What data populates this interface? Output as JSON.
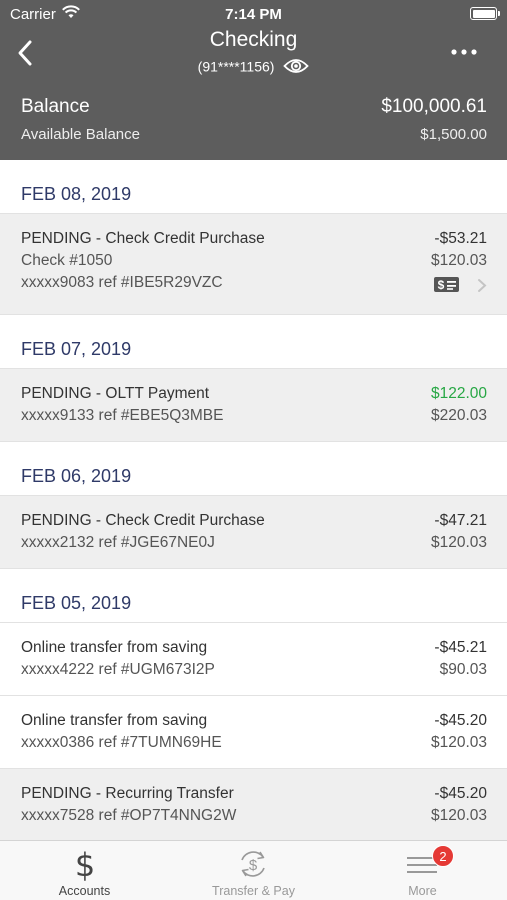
{
  "status_bar": {
    "carrier": "Carrier",
    "time": "7:14 PM"
  },
  "header": {
    "title": "Checking",
    "account_number": "(91****1156)",
    "balance_label": "Balance",
    "balance_value": "$100,000.61",
    "available_label": "Available Balance",
    "available_value": "$1,500.00"
  },
  "groups": [
    {
      "date": "FEB 08, 2019",
      "items": [
        {
          "description": "PENDING - Check Credit Purchase",
          "check": "Check #1050",
          "ref": "xxxxx9083 ref #IBE5R29VZC",
          "amount": "-$53.21",
          "balance": "$120.03"
        }
      ]
    },
    {
      "date": "FEB 07, 2019",
      "items": [
        {
          "description": "PENDING - OLTT Payment",
          "ref": "xxxxx9133 ref #EBE5Q3MBE",
          "amount": "$122.00",
          "balance": "$220.03"
        }
      ]
    },
    {
      "date": "FEB 06, 2019",
      "items": [
        {
          "description": "PENDING - Check Credit Purchase",
          "ref": "xxxxx2132 ref #JGE67NE0J",
          "amount": "-$47.21",
          "balance": "$120.03"
        }
      ]
    },
    {
      "date": "FEB 05, 2019",
      "items": [
        {
          "description": "Online transfer from saving",
          "ref": "xxxxx4222 ref #UGM673I2P",
          "amount": "-$45.21",
          "balance": "$90.03"
        },
        {
          "description": "Online transfer from saving",
          "ref": "xxxxx0386 ref #7TUMN69HE",
          "amount": "-$45.20",
          "balance": "$120.03"
        },
        {
          "description": "PENDING - Recurring Transfer",
          "ref": "xxxxx7528 ref #OP7T4NNG2W",
          "amount": "-$45.20",
          "balance": "$120.03"
        }
      ]
    }
  ],
  "tabbar": {
    "accounts": "Accounts",
    "transfer_pay": "Transfer & Pay",
    "more": "More",
    "more_badge": "2"
  },
  "colors": {
    "header_bg": "#5d5d5d",
    "date_header": "#2f3a68",
    "credit_amount": "#27a744",
    "badge": "#e53935"
  }
}
